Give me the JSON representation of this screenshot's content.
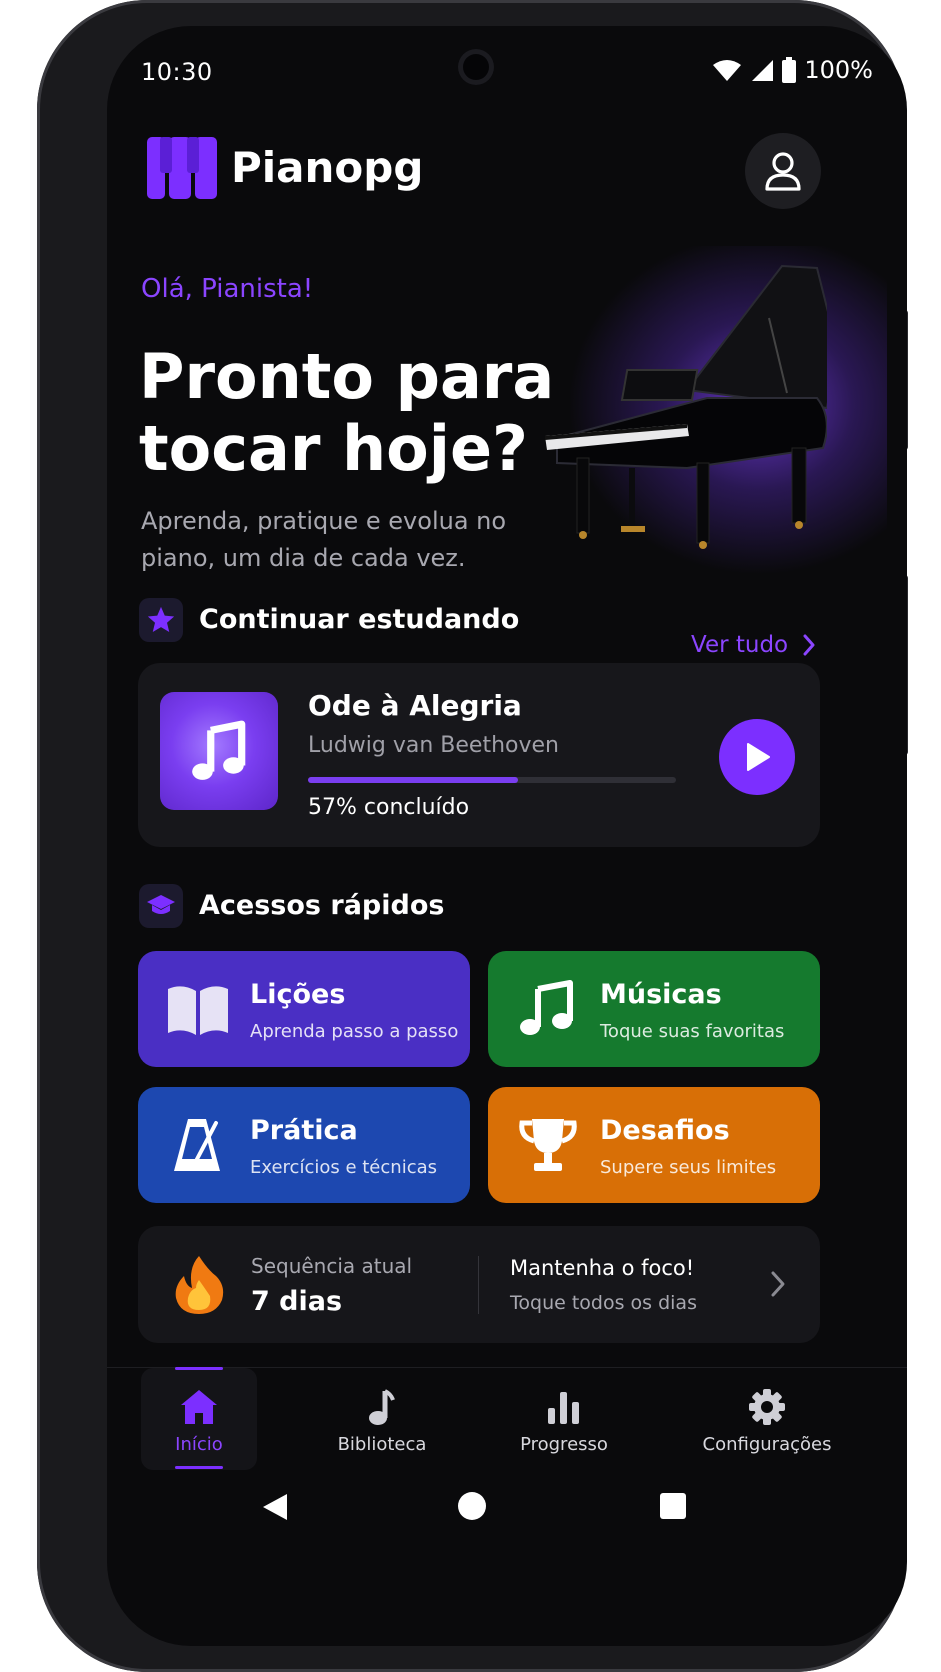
{
  "status_bar": {
    "time": "10:30",
    "battery": "100%"
  },
  "header": {
    "app_name": "Pianopg"
  },
  "hero": {
    "greeting": "Olá, Pianista!",
    "headline": "Pronto para tocar hoje?",
    "subline": "Aprenda, pratique e evolua no piano, um dia de cada vez."
  },
  "continue_section": {
    "title": "Continuar estudando",
    "see_all": "Ver tudo",
    "song": {
      "title": "Ode à Alegria",
      "artist": "Ludwig van Beethoven",
      "progress": 0.57,
      "progress_label": "57% concluído"
    }
  },
  "quick_access": {
    "title": "Acessos rápidos",
    "tiles": [
      {
        "title": "Lições",
        "subtitle": "Aprenda passo a passo",
        "color": "#4a2fc4",
        "icon": "book-icon"
      },
      {
        "title": "Músicas",
        "subtitle": "Toque suas favoritas",
        "color": "#157a2e",
        "icon": "music-note-icon"
      },
      {
        "title": "Prática",
        "subtitle": "Exercícios e técnicas",
        "color": "#1d48b0",
        "icon": "metronome-icon"
      },
      {
        "title": "Desafios",
        "subtitle": "Supere seus limites",
        "color": "#d86f06",
        "icon": "trophy-icon"
      }
    ]
  },
  "streak": {
    "label": "Sequência atual",
    "value": "7 dias",
    "focus_title": "Mantenha o foco!",
    "focus_subtitle": "Toque todos os dias"
  },
  "bottom_nav": {
    "items": [
      {
        "label": "Início",
        "icon": "home-icon",
        "active": true
      },
      {
        "label": "Biblioteca",
        "icon": "music-note-icon",
        "active": false
      },
      {
        "label": "Progresso",
        "icon": "bar-chart-icon",
        "active": false
      },
      {
        "label": "Configurações",
        "icon": "gear-icon",
        "active": false
      }
    ]
  },
  "colors": {
    "accent": "#7c2fff",
    "background": "#0a0a0c",
    "card": "#17171b"
  }
}
